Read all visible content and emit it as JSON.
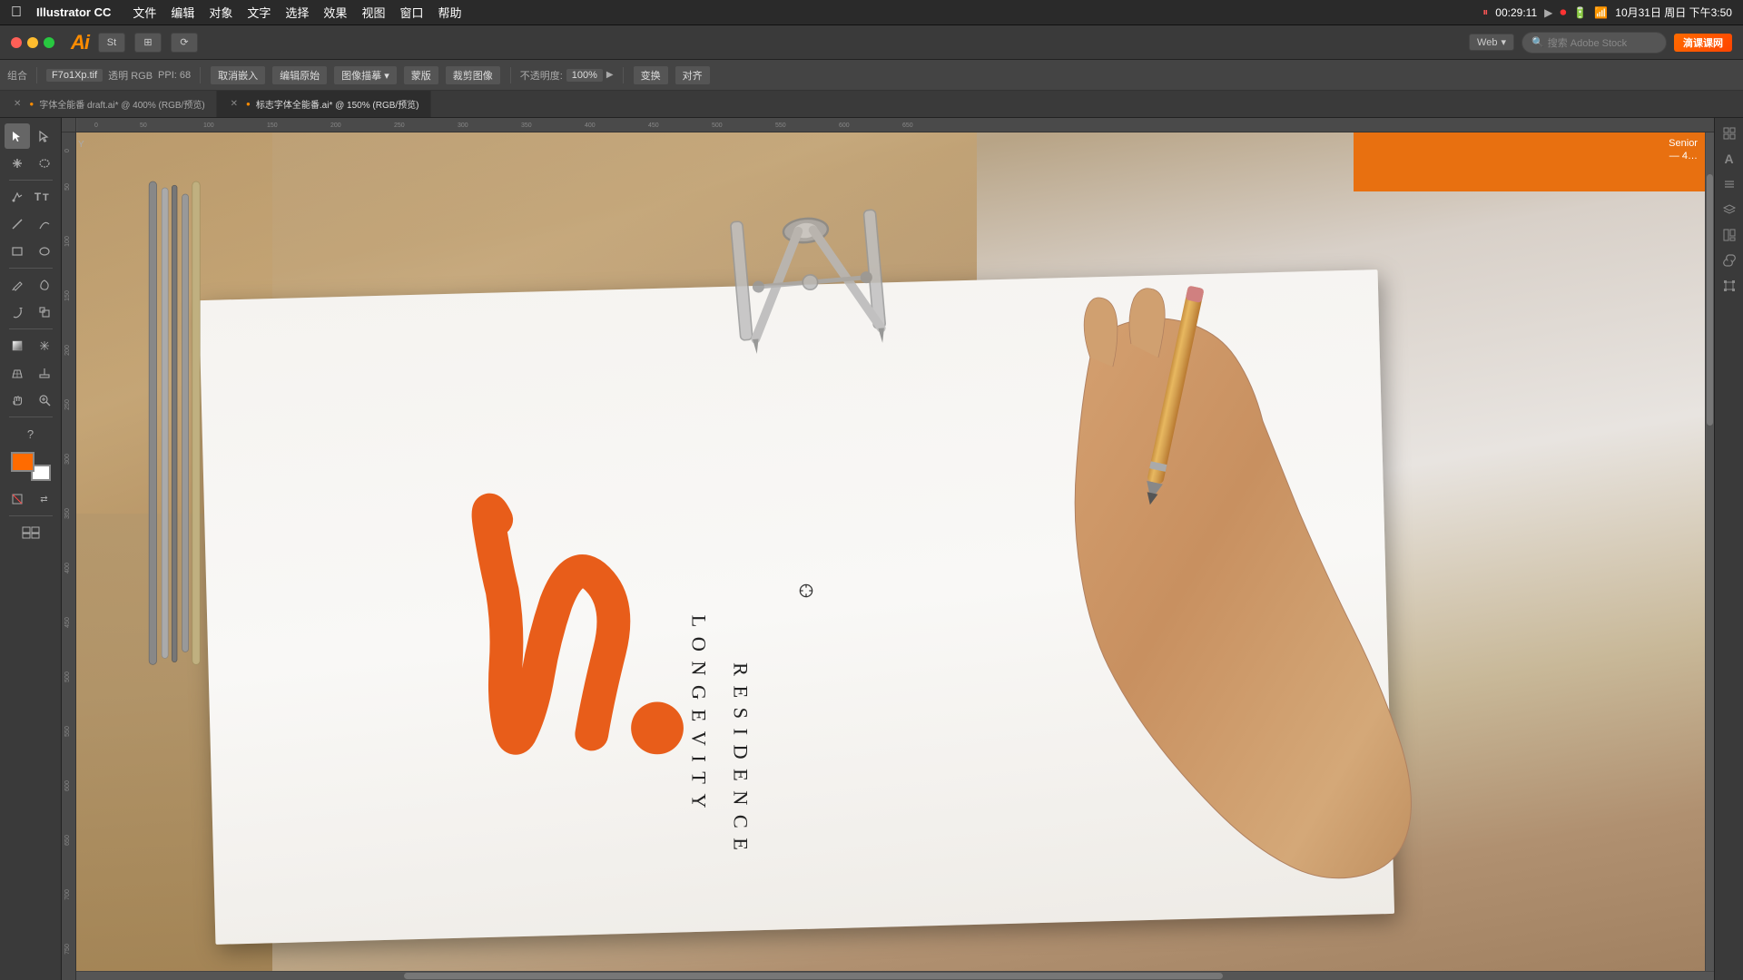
{
  "menubar": {
    "apple": "⌘",
    "app_name": "Illustrator CC",
    "items": [
      "文件",
      "编辑",
      "对象",
      "文字",
      "选择",
      "效果",
      "视图",
      "窗口",
      "帮助"
    ],
    "time": "10月31日 周日 下午3:50",
    "clock": "00:29:11"
  },
  "titlebar": {
    "app_icon": "Ai",
    "buttons": [
      "St",
      "⊞",
      "⟳"
    ],
    "web_label": "Web",
    "search_placeholder": "搜索 Adobe Stock",
    "watermark": "滴课课网"
  },
  "toolbar2": {
    "filename": "F7o1Xp.tif",
    "color_mode": "透明 RGB",
    "ppi": "PPI: 68",
    "btn_embed": "取消嵌入",
    "btn_edit": "编辑原始",
    "btn_trace": "图像描摹",
    "btn_trace_arrow": "▾",
    "btn_meng": "蒙版",
    "btn_crop": "裁剪图像",
    "opacity_label": "不透明度:",
    "opacity_val": "100%",
    "opacity_arrow": "▶",
    "transform_btn": "变换",
    "align_btn": "对齐"
  },
  "tabs": [
    {
      "label": "字体全能番 draft.ai* @ 400% (RGB/预览)",
      "active": false,
      "modified": true
    },
    {
      "label": "标志字体全能番.ai* @ 150% (RGB/预览)",
      "active": true,
      "modified": true
    }
  ],
  "sidebar": {
    "group_label": "组合",
    "tools": [
      "selection",
      "direct-selection",
      "magic-wand",
      "lasso",
      "pen",
      "add-anchor",
      "delete-anchor",
      "convert-anchor",
      "type",
      "type-vertical",
      "type-area",
      "type-path",
      "line",
      "arc",
      "spiral",
      "grid",
      "rect",
      "rounded-rect",
      "ellipse",
      "polygon",
      "pencil",
      "smooth",
      "blob-brush",
      "erase",
      "rotate",
      "scale",
      "shear",
      "reshape",
      "gradient",
      "mesh",
      "shape-builder",
      "live-paint",
      "perspective",
      "measure",
      "slice",
      "scissors",
      "hand",
      "zoom",
      "question"
    ]
  },
  "canvas": {
    "zoom": "150%",
    "ruler_visible": true
  },
  "artwork": {
    "logo_text1": "LONGEVITY",
    "logo_text2": "RESIDENCE",
    "orange_color": "#e85d1a"
  },
  "right_panel": {
    "buttons": [
      "⊞",
      "A",
      "≡",
      "⊟",
      "⊞",
      "≡",
      "☰",
      "⊕"
    ]
  }
}
